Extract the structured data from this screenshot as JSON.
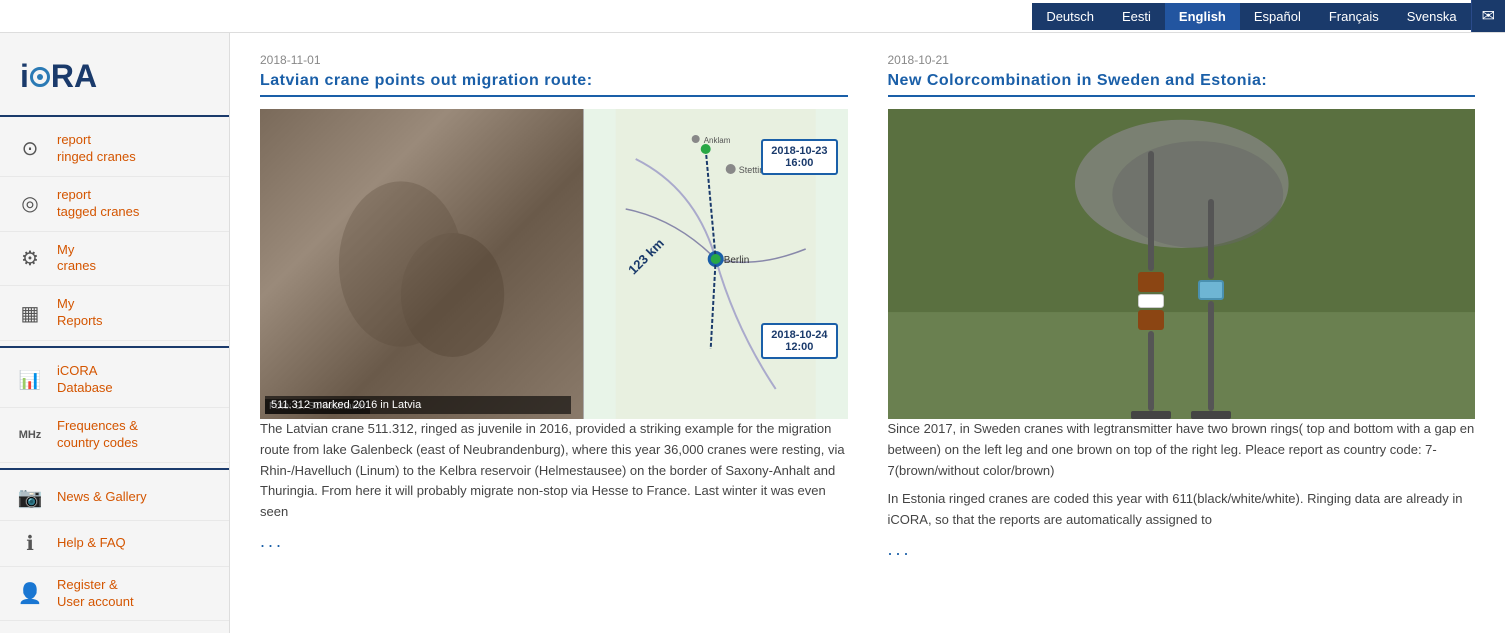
{
  "header": {
    "languages": [
      {
        "code": "de",
        "label": "Deutsch",
        "active": false
      },
      {
        "code": "et",
        "label": "Eesti",
        "active": false
      },
      {
        "code": "en",
        "label": "English",
        "active": true
      },
      {
        "code": "es",
        "label": "Español",
        "active": false
      },
      {
        "code": "fr",
        "label": "Français",
        "active": false
      },
      {
        "code": "sv",
        "label": "Svenska",
        "active": false
      }
    ]
  },
  "sidebar": {
    "logo": "iCORA",
    "items": [
      {
        "id": "report-ringed",
        "icon": "⊙",
        "label": "report\nringed cranes"
      },
      {
        "id": "report-tagged",
        "icon": "◎",
        "label": "report\ntagged cranes"
      },
      {
        "id": "my-cranes",
        "icon": "⚙",
        "label": "My\ncranes"
      },
      {
        "id": "my-reports",
        "icon": "▦",
        "label": "My\nReports"
      },
      {
        "id": "icora-db",
        "icon": "▐",
        "label": "iCORA\nDatabase"
      },
      {
        "id": "frequences",
        "icon": "MHz",
        "label": "Frequences &\ncountry codes"
      },
      {
        "id": "news-gallery",
        "icon": "📷",
        "label": "News & Gallery"
      },
      {
        "id": "help-faq",
        "icon": "ℹ",
        "label": "Help & FAQ"
      },
      {
        "id": "register",
        "icon": "👤",
        "label": "Register &\nUser account"
      }
    ]
  },
  "articles": [
    {
      "id": "article-1",
      "date": "2018-11-01",
      "title": "Latvian crane points out migration route:",
      "image_caption": "Foto: G. Schlotzhauer",
      "map_label1": "511.312 marked 2016 in Latvia",
      "map_box1_line1": "2018-10-23",
      "map_box1_line2": "16:00",
      "map_box2_line1": "2018-10-24",
      "map_box2_line2": "12:00",
      "map_km": "123 km",
      "text": "The Latvian crane 511.312, ringed as juvenile in 2016, provided a striking example for the migration route from lake Galenbeck (east of Neubrandenburg), where this year 36,000 cranes were resting, via Rhin-/Havelluch (Linum) to the Kelbra reservoir (Helmestausee) on the border of Saxony-Anhalt and Thuringia. From here it will probably migrate non-stop via Hesse to France. Last winter it was even seen",
      "more": "..."
    },
    {
      "id": "article-2",
      "date": "2018-10-21",
      "title": "New Colorcombination in Sweden and Estonia:",
      "text1": "Since 2017, in Sweden cranes with legtransmitter have two brown rings( top and bottom with a gap en between) on the left leg and one brown on top of the right leg. Pleace report as country code: 7-7(brown/without color/brown)",
      "text2": "In Estonia ringed cranes are coded this year with 611(black/white/white). Ringing data are already in iCORA, so that the reports are automatically assigned to",
      "more": "..."
    }
  ]
}
